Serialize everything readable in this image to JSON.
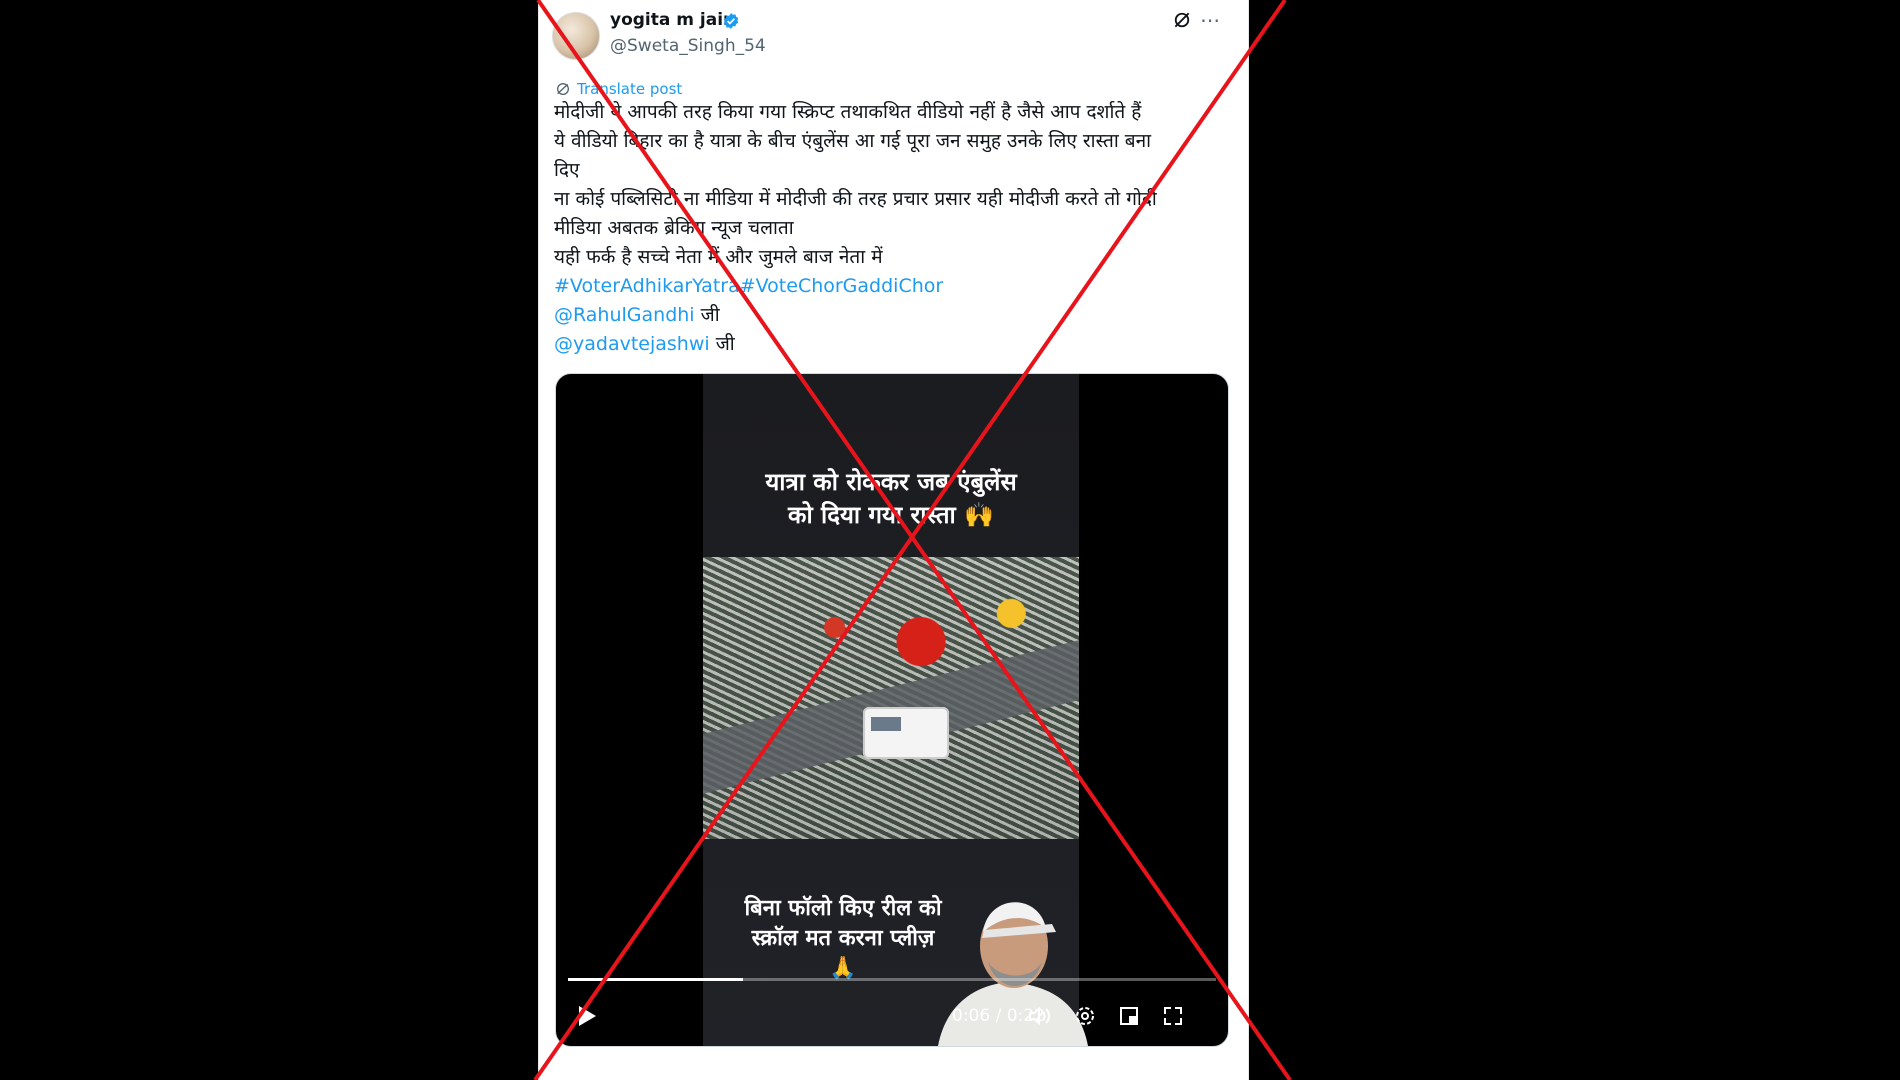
{
  "post": {
    "display_name": "yogita m jain",
    "handle": "@Sweta_Singh_54",
    "translate_label": "Translate post",
    "lines": [
      "मोदीजी ये आपकी तरह किया गया स्क्रिप्ट तथाकथित वीडियो नहीं है जैसे आप दर्शाते हैं",
      "ये वीडियो बिहार का है यात्रा के बीच एंबुलेंस आ गई पूरा जन समुह उनके लिए रास्ता बना",
      "दिए",
      "ना कोई पब्लिसिटी ना मीडिया में मोदीजी की तरह प्रचार प्रसार यही मोदीजी करते तो गोदी",
      "मीडिया अबतक ब्रेकिंग न्यूज चलाता",
      "यही फर्क है सच्चे नेता में और जुमले बाज नेता में"
    ],
    "hashtag_1": "#VoterAdhikarYatra",
    "hashtag_2": "#VoteChorGaddiChor",
    "mention_1": "@RahulGandhi",
    "mention_1_suffix": " जी",
    "mention_2": "@yadavtejashwi",
    "mention_2_suffix": " जी"
  },
  "video": {
    "caption_top_line1": "यात्रा को रोककर जब एंबुलेंस",
    "caption_top_line2": "को दिया गया रास्ता 🙌",
    "caption_bottom_line1": "बिना फॉलो किए रील को",
    "caption_bottom_line2": "स्क्रॉल मत करना प्लीज़",
    "caption_bottom_line3": "🙏",
    "time": "0:06 / 0:22",
    "progress_fraction": 0.27
  },
  "colors": {
    "link": "#1d9bf0",
    "verified": "#1d9bf0",
    "cross": "#e8141b"
  },
  "icons": [
    "verified-badge-icon",
    "grok-icon",
    "more-icon",
    "globe-icon",
    "play-icon",
    "volume-icon",
    "settings-icon",
    "pip-icon",
    "fullscreen-icon"
  ]
}
